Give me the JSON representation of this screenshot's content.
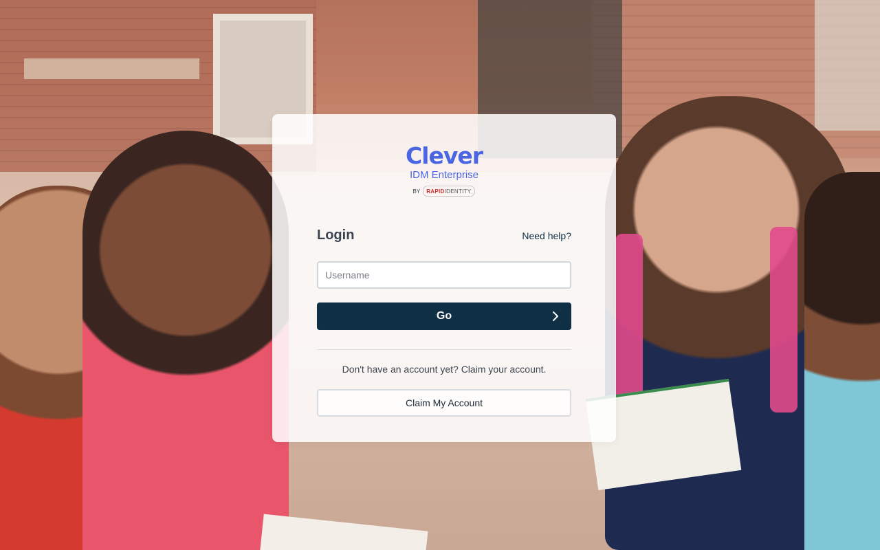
{
  "brand": {
    "name": "Clever",
    "product": "IDM Enterprise",
    "by": "BY",
    "partner_part1": "RAPID",
    "partner_part2": "IDENTITY",
    "color": "#4a66e3"
  },
  "login": {
    "title": "Login",
    "help_link": "Need help?",
    "username_placeholder": "Username",
    "username_value": "",
    "go_label": "Go",
    "go_color": "#0f2f44"
  },
  "claim": {
    "prompt": "Don't have an account yet? Claim your account.",
    "button_label": "Claim My Account"
  },
  "icons": {
    "go_arrow": "chevron-right-icon",
    "partner_logo": "rapididentity-logo"
  }
}
